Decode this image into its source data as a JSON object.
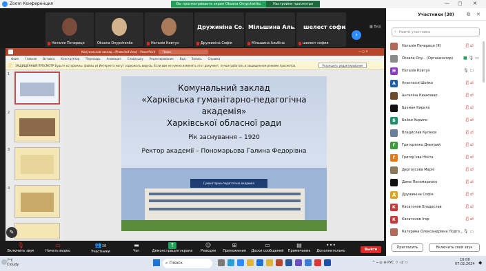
{
  "window": {
    "title": "Zoom Конференция"
  },
  "banner": {
    "viewing": "Вы просматриваете экран Oksana Onypchenko",
    "view_options": "Настройки просмотра"
  },
  "participants_strip": [
    {
      "name": "Наталія Печериця"
    },
    {
      "name": "Oksana Onypchenko"
    },
    {
      "name": "Наталія Ковтун"
    },
    {
      "big": "Дружиніна Со...",
      "name": "Дружиніна Софія"
    },
    {
      "big": "Мільшина Аль...",
      "name": "Мільшина Альбіна"
    },
    {
      "big": "шелест софия",
      "name": "шелест софия"
    }
  ],
  "view_label": "Вид",
  "ppt": {
    "title": "Комунальний заклад...(Protected View) - PowerPoint",
    "search": "Поиск",
    "menu": [
      "Файл",
      "Главная",
      "Вставка",
      "Конструктор",
      "Переходы",
      "Анимация",
      "Слайд-шоу",
      "Рецензирование",
      "Вид",
      "Запись",
      "Справка"
    ],
    "warning": "ЗАЩИЩЕННЫЙ ПРОСМОТР Будьте осторожны: файлы из Интернета могут содержать вирусы. Если вам не нужно изменять этот документ, лучше работать в защищенном режиме просмотра.",
    "enable_edit": "Разрешить редактирование",
    "slide_numbers": [
      "1",
      "2",
      "3",
      "4"
    ],
    "slide": {
      "line1": "Комунальний заклад",
      "line2": "«Харківська гуманітарно-педагогічна",
      "line3": "академія»",
      "line4": "Харківської обласної ради",
      "line5": "Рік заснування – 1920",
      "line6": "Ректор академії – Пономарьова Галина Федорівна",
      "plaque": "Гуманітарно-педагогічна академія"
    }
  },
  "panel": {
    "title": "Участники (38)",
    "search_placeholder": "Найти участника",
    "participants": [
      {
        "name": "Наталія Печериця (Я)",
        "initial": "",
        "color": "#b06a5a"
      },
      {
        "name": "Oksana Ony... (Организатор)",
        "initial": "",
        "color": "#8a8a8a"
      },
      {
        "name": "Наталія Ковтун",
        "initial": "H",
        "color": "#8a3fc2"
      },
      {
        "name": "Анастасія Шейко",
        "initial": "A",
        "color": "#1b5fa6"
      },
      {
        "name": "Ангеліна Кишковар",
        "initial": "",
        "color": "#6b4b2a"
      },
      {
        "name": "Бахман Кирило",
        "initial": "",
        "color": "#111111"
      },
      {
        "name": "Бойко Кирило",
        "initial": "Б",
        "color": "#1f8f6a"
      },
      {
        "name": "Владислав Куліков",
        "initial": "",
        "color": "#6a7f9a"
      },
      {
        "name": "Григоренко Дмитрий",
        "initial": "Г",
        "color": "#3a9b3a"
      },
      {
        "name": "Григор'єва Нікіта",
        "initial": "Г",
        "color": "#e07a1a"
      },
      {
        "name": "Дергоусова Марія",
        "initial": "",
        "color": "#8a7a5a"
      },
      {
        "name": "Дима Пономаренко",
        "initial": "",
        "color": "#111111"
      },
      {
        "name": "Дружиніна Софія",
        "initial": "Д",
        "color": "#e0a21a"
      },
      {
        "name": "Касатонов Владислав",
        "initial": "К",
        "color": "#c43a3a"
      },
      {
        "name": "Касатонов Ігор",
        "initial": "К",
        "color": "#c43a3a"
      },
      {
        "name": "Катерина Олександрівна Подго...",
        "initial": "",
        "color": "#b06a5a"
      }
    ],
    "invite": "Пригласить",
    "unmute_me": "Включить свой звук"
  },
  "toolbar": {
    "items": [
      "Включить звук",
      "Начать видео",
      "Участники",
      "Чат",
      "Демонстрация экрана",
      "Реакции",
      "Приложения",
      "Доски сообщений",
      "Примечания",
      "Дополнительно"
    ],
    "participants_count": "38",
    "leave": "Выйти"
  },
  "taskbar": {
    "temp": "7°C",
    "weather": "Cloudy",
    "search": "Поиск",
    "lang": "РУС",
    "time": "16:08",
    "date": "07.02.2024"
  }
}
